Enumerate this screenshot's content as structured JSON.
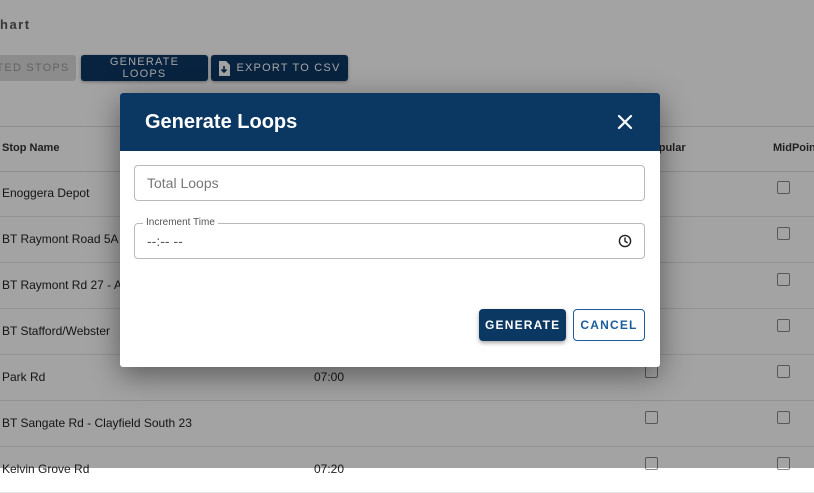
{
  "page": {
    "title": "hart"
  },
  "toolbar": {
    "disabled_label": "TED STOPS",
    "generate_loops_label": "GENERATE LOOPS",
    "export_label": "EXPORT TO CSV"
  },
  "table": {
    "headers": {
      "stop_name": "Stop Name",
      "popular": "opular",
      "midpoint": "MidPoin"
    },
    "rows": [
      {
        "stop_name": "Enoggera Depot",
        "time": ""
      },
      {
        "stop_name": "BT Raymont Road 5A",
        "time": ""
      },
      {
        "stop_name": "BT Raymont Rd 27 - A",
        "time": ""
      },
      {
        "stop_name": "BT Stafford/Webster",
        "time": ""
      },
      {
        "stop_name": "Park Rd",
        "time": "07:00"
      },
      {
        "stop_name": "BT Sangate Rd - Clayfield South 23",
        "time": ""
      },
      {
        "stop_name": "Kelvin Grove Rd",
        "time": "07:20"
      }
    ]
  },
  "dialog": {
    "title": "Generate Loops",
    "total_loops_placeholder": "Total Loops",
    "increment_label": "Increment Time",
    "increment_value": "--:-- --",
    "generate_label": "GENERATE",
    "cancel_label": "CANCEL"
  },
  "colors": {
    "primary": "#0b3763",
    "accent": "#1c5c9c"
  },
  "icons": {
    "close": "close-icon",
    "clock": "clock-icon",
    "export": "file-download-icon"
  }
}
